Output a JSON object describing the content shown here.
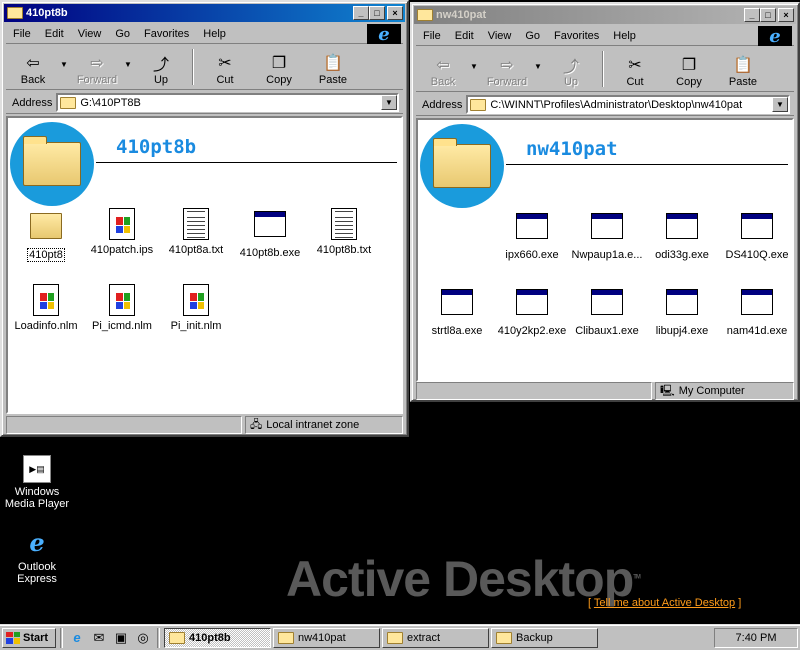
{
  "window1": {
    "title": "410pt8b",
    "menu": [
      "File",
      "Edit",
      "View",
      "Go",
      "Favorites",
      "Help"
    ],
    "toolbar": {
      "back": "Back",
      "forward": "Forward",
      "up": "Up",
      "cut": "Cut",
      "copy": "Copy",
      "paste": "Paste"
    },
    "address_label": "Address",
    "address_value": "G:\\410PT8B",
    "folder_title": "410pt8b",
    "files": [
      {
        "name": "410pt8",
        "type": "folder"
      },
      {
        "name": "410patch.ips",
        "type": "doc"
      },
      {
        "name": "410pt8a.txt",
        "type": "txt"
      },
      {
        "name": "410pt8b.exe",
        "type": "exe"
      },
      {
        "name": "410pt8b.txt",
        "type": "txt"
      },
      {
        "name": "Loadinfo.nlm",
        "type": "doc"
      },
      {
        "name": "Pi_icmd.nlm",
        "type": "doc"
      },
      {
        "name": "Pi_init.nlm",
        "type": "doc"
      }
    ],
    "status_zone": "Local intranet zone"
  },
  "window2": {
    "title": "nw410pat",
    "menu": [
      "File",
      "Edit",
      "View",
      "Go",
      "Favorites",
      "Help"
    ],
    "toolbar": {
      "back": "Back",
      "forward": "Forward",
      "up": "Up",
      "cut": "Cut",
      "copy": "Copy",
      "paste": "Paste"
    },
    "address_label": "Address",
    "address_value": "C:\\WINNT\\Profiles\\Administrator\\Desktop\\nw410pat",
    "folder_title": "nw410pat",
    "files": [
      {
        "name": "ipx660.exe"
      },
      {
        "name": "Nwpaup1a.e..."
      },
      {
        "name": "odi33g.exe"
      },
      {
        "name": "DS410Q.exe"
      },
      {
        "name": "strtl8a.exe"
      },
      {
        "name": "410y2kp2.exe"
      },
      {
        "name": "Clibaux1.exe"
      },
      {
        "name": "libupj4.exe"
      },
      {
        "name": "nam41d.exe"
      }
    ],
    "status_zone": "My Computer"
  },
  "desktop": {
    "icons": [
      {
        "label": "Windows Media Player",
        "icon": "media-player-icon"
      },
      {
        "label": "Outlook Express",
        "icon": "outlook-express-icon"
      }
    ],
    "active_desktop_text": "Active Desktop",
    "tm": "TM",
    "tell_me_link": "Tell me about Active Desktop"
  },
  "taskbar": {
    "start_label": "Start",
    "tasks": [
      "410pt8b",
      "nw410pat",
      "extract",
      "Backup"
    ],
    "active_task": "410pt8b",
    "clock": "7:40 PM"
  }
}
